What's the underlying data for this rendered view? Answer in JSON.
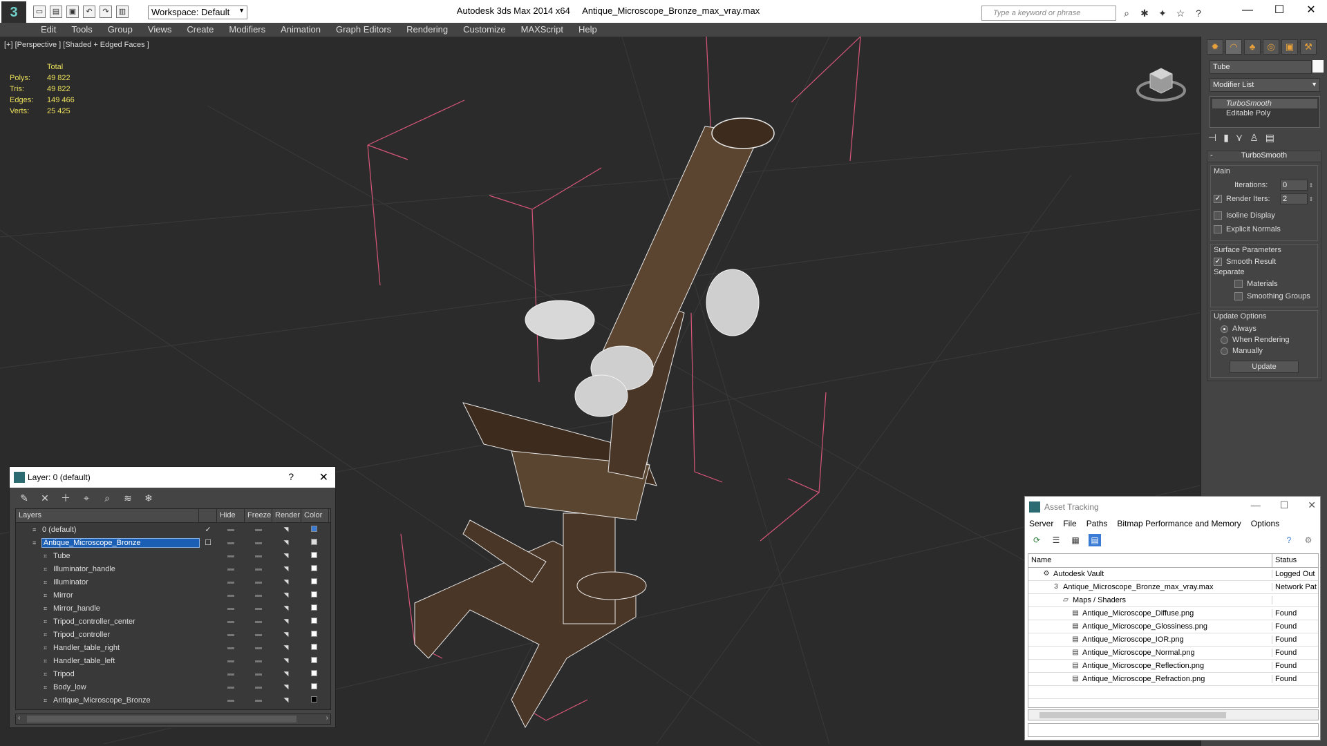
{
  "titlebar": {
    "workspace": "Workspace: Default",
    "app_title": "Autodesk 3ds Max  2014 x64",
    "file_title": "Antique_Microscope_Bronze_max_vray.max",
    "search_placeholder": "Type a keyword or phrase"
  },
  "menu": [
    "Edit",
    "Tools",
    "Group",
    "Views",
    "Create",
    "Modifiers",
    "Animation",
    "Graph Editors",
    "Rendering",
    "Customize",
    "MAXScript",
    "Help"
  ],
  "viewport": {
    "label": "[+] [Perspective ] [Shaded + Edged Faces ]",
    "stats": {
      "header": "Total",
      "rows": [
        {
          "k": "Polys:",
          "v": "49 822"
        },
        {
          "k": "Tris:",
          "v": "49 822"
        },
        {
          "k": "Edges:",
          "v": "149 466"
        },
        {
          "k": "Verts:",
          "v": "25 425"
        }
      ]
    }
  },
  "command_panel": {
    "object_name": "Tube",
    "modifier_list": "Modifier List",
    "stack": [
      "TurboSmooth",
      "Editable Poly"
    ],
    "rollout_title": "TurboSmooth",
    "main_group": "Main",
    "iterations_label": "Iterations:",
    "iterations_value": "0",
    "render_iters_label": "Render Iters:",
    "render_iters_value": "2",
    "isoline_label": "Isoline Display",
    "explicit_label": "Explicit Normals",
    "surface_group": "Surface Parameters",
    "smooth_label": "Smooth Result",
    "separate_label": "Separate",
    "materials_label": "Materials",
    "smoothing_label": "Smoothing Groups",
    "update_group": "Update Options",
    "always_label": "Always",
    "when_rendering_label": "When Rendering",
    "manually_label": "Manually",
    "update_button": "Update"
  },
  "layer_window": {
    "title": "Layer: 0 (default)",
    "help": "?",
    "columns": [
      "Layers",
      "Hide",
      "Freeze",
      "Render",
      "Color"
    ],
    "rows": [
      {
        "name": "0 (default)",
        "level": 0,
        "color": "#3a7bd5"
      },
      {
        "name": "Antique_Microscope_Bronze",
        "level": 0,
        "color": "#dddddd"
      },
      {
        "name": "Tube",
        "level": 1,
        "color": "#ffffff"
      },
      {
        "name": "Illuminator_handle",
        "level": 1,
        "color": "#ffffff"
      },
      {
        "name": "Illuminator",
        "level": 1,
        "color": "#ffffff"
      },
      {
        "name": "Mirror",
        "level": 1,
        "color": "#ffffff"
      },
      {
        "name": "Mirror_handle",
        "level": 1,
        "color": "#ffffff"
      },
      {
        "name": "Tripod_controller_center",
        "level": 1,
        "color": "#ffffff"
      },
      {
        "name": "Tripod_controller",
        "level": 1,
        "color": "#ffffff"
      },
      {
        "name": "Handler_table_right",
        "level": 1,
        "color": "#ffffff"
      },
      {
        "name": "Handler_table_left",
        "level": 1,
        "color": "#ffffff"
      },
      {
        "name": "Tripod",
        "level": 1,
        "color": "#ffffff"
      },
      {
        "name": "Body_low",
        "level": 1,
        "color": "#ffffff"
      },
      {
        "name": "Antique_Microscope_Bronze",
        "level": 1,
        "color": "#000000"
      }
    ]
  },
  "asset_window": {
    "title": "Asset Tracking",
    "menu": [
      "Server",
      "File",
      "Paths",
      "Bitmap Performance and Memory",
      "Options"
    ],
    "col_name": "Name",
    "col_status": "Status",
    "rows": [
      {
        "name": "Autodesk Vault",
        "status": "Logged Out",
        "level": 0
      },
      {
        "name": "Antique_Microscope_Bronze_max_vray.max",
        "status": "Network Pat",
        "level": 1
      },
      {
        "name": "Maps / Shaders",
        "status": "",
        "level": 2
      },
      {
        "name": "Antique_Microscope_Diffuse.png",
        "status": "Found",
        "level": 3
      },
      {
        "name": "Antique_Microscope_Glossiness.png",
        "status": "Found",
        "level": 3
      },
      {
        "name": "Antique_Microscope_IOR.png",
        "status": "Found",
        "level": 3
      },
      {
        "name": "Antique_Microscope_Normal.png",
        "status": "Found",
        "level": 3
      },
      {
        "name": "Antique_Microscope_Reflection.png",
        "status": "Found",
        "level": 3
      },
      {
        "name": "Antique_Microscope_Refraction.png",
        "status": "Found",
        "level": 3
      }
    ]
  }
}
